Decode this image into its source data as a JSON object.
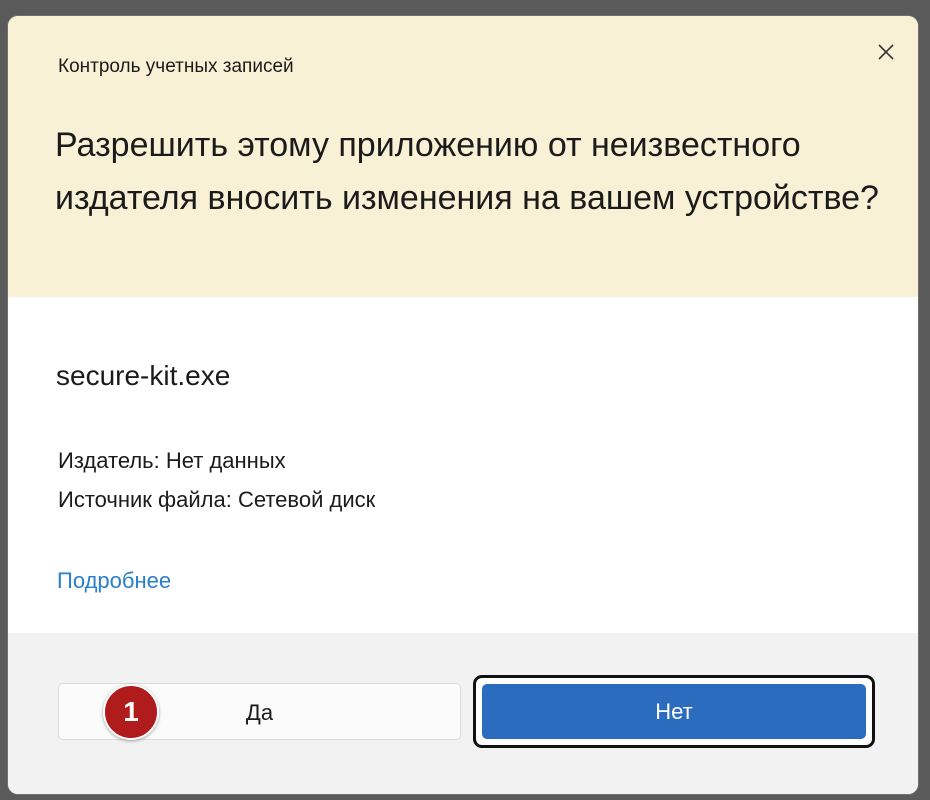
{
  "window": {
    "app_title": "Контроль учетных записей",
    "close_icon": "close-icon"
  },
  "prompt": {
    "question": "Разрешить этому приложению от неизвестного издателя вносить изменения на вашем устройстве?"
  },
  "program": {
    "name": "secure-kit.exe",
    "publisher": "Издатель: Нет данных",
    "source": "Источник файла: Сетевой диск",
    "details_link": "Подробнее"
  },
  "buttons": {
    "yes_label": "Да",
    "no_label": "Нет"
  },
  "annotation": {
    "badge_number": "1"
  },
  "colors": {
    "header_background": "#f9f1d6",
    "primary_button": "#2b6cbe",
    "link": "#2a7fc9",
    "badge": "#b01b1b",
    "footer_background": "#f2f2f2"
  }
}
